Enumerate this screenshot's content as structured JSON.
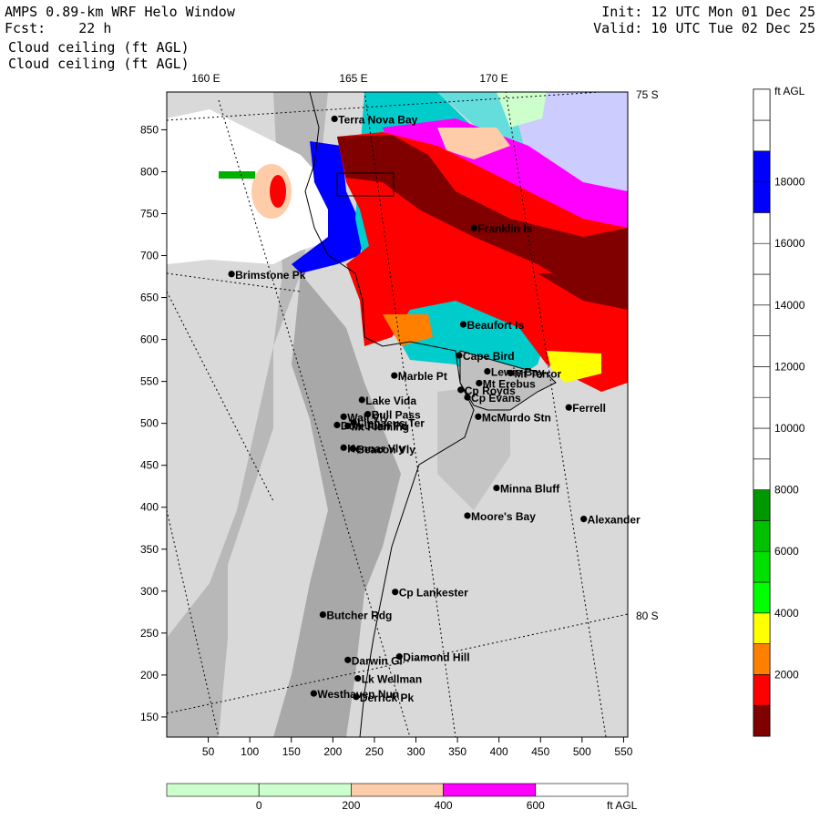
{
  "header": {
    "title": "AMPS 0.89-km WRF Helo Window",
    "forecast": "Fcst:    22 h",
    "field_line1": "Cloud ceiling (ft AGL)",
    "field_line2": "Cloud ceiling (ft AGL)",
    "init": "Init: 12 UTC Mon 01 Dec 25",
    "valid": "Valid: 10 UTC Tue 02 Dec 25"
  },
  "grid": {
    "lon_labels": [
      "160 E",
      "165 E",
      "170 E"
    ],
    "lat_labels": [
      "75 S",
      "80 S"
    ],
    "x_ticks": [
      50,
      100,
      150,
      200,
      250,
      300,
      350,
      400,
      450,
      500,
      550
    ],
    "y_ticks": [
      150,
      200,
      250,
      300,
      350,
      400,
      450,
      500,
      550,
      600,
      650,
      700,
      750,
      800,
      850
    ],
    "x_range": [
      0,
      555
    ],
    "y_range": [
      126,
      895
    ]
  },
  "places": [
    {
      "name": "Terra Nova Bay",
      "x": 202,
      "y": 863
    },
    {
      "name": "Franklin Is",
      "x": 370,
      "y": 733
    },
    {
      "name": "Brimstone Pk",
      "x": 78,
      "y": 678
    },
    {
      "name": "Beaufort Is",
      "x": 357,
      "y": 618
    },
    {
      "name": "Cape Bird",
      "x": 352,
      "y": 581
    },
    {
      "name": "Lewis Bay",
      "x": 386,
      "y": 562
    },
    {
      "name": "Mt Terror",
      "x": 414,
      "y": 560
    },
    {
      "name": "Marble Pt",
      "x": 274,
      "y": 557
    },
    {
      "name": "Cp Royds",
      "x": 354,
      "y": 540
    },
    {
      "name": "Mt Erebus",
      "x": 376,
      "y": 548
    },
    {
      "name": "Cp Evans",
      "x": 362,
      "y": 531
    },
    {
      "name": "Lake Vida",
      "x": 235,
      "y": 528
    },
    {
      "name": "Wall Vly",
      "x": 213,
      "y": 508
    },
    {
      "name": "Bull Pass",
      "x": 242,
      "y": 511
    },
    {
      "name": "Don Juan Pd",
      "x": 205,
      "y": 498
    },
    {
      "name": "Mt Fleming",
      "x": 218,
      "y": 497
    },
    {
      "name": "Linnaeus Ter",
      "x": 225,
      "y": 501
    },
    {
      "name": "McMurdo Stn",
      "x": 375,
      "y": 508
    },
    {
      "name": "Ferrell",
      "x": 484,
      "y": 519
    },
    {
      "name": "Kennar Vly",
      "x": 213,
      "y": 471
    },
    {
      "name": "Beacon Vly",
      "x": 224,
      "y": 470
    },
    {
      "name": "Minna Bluff",
      "x": 397,
      "y": 423
    },
    {
      "name": "Moore's Bay",
      "x": 362,
      "y": 390
    },
    {
      "name": "Alexander",
      "x": 502,
      "y": 386
    },
    {
      "name": "Cp Lankester",
      "x": 275,
      "y": 299
    },
    {
      "name": "Butcher Rdg",
      "x": 188,
      "y": 272
    },
    {
      "name": "Darwin Gl",
      "x": 218,
      "y": 218
    },
    {
      "name": "Diamond Hill",
      "x": 280,
      "y": 222
    },
    {
      "name": "Lk Wellman",
      "x": 230,
      "y": 196
    },
    {
      "name": "Westhaven Nun",
      "x": 177,
      "y": 178
    },
    {
      "name": "Derrick Pk",
      "x": 228,
      "y": 174
    }
  ],
  "legend_right": {
    "unit": "ft AGL",
    "labels": [
      "18000",
      "16000",
      "14000",
      "12000",
      "10000",
      "8000",
      "6000",
      "4000",
      "2000"
    ],
    "colors": [
      "#800000",
      "#ff0000",
      "#ff8000",
      "#ffff00",
      "#00ff00",
      "#00e000",
      "#00c000",
      "#009800",
      "#ffffff",
      "#ffffff",
      "#ffffff",
      "#ffffff",
      "#ffffff",
      "#ffffff",
      "#ffffff",
      "#ffffff",
      "#ffffff",
      "#0000ff",
      "#0000ff",
      "#ffffff"
    ]
  },
  "legend_bottom": {
    "unit": "ft AGL",
    "labels": [
      "0",
      "200",
      "400",
      "600"
    ],
    "colors": [
      "#ccffcc",
      "#ccffcc",
      "#ffccaa",
      "#ff00ff",
      "#ffffff"
    ]
  }
}
